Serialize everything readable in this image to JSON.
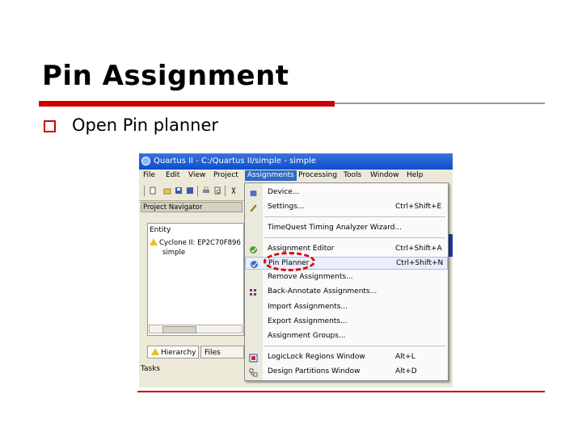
{
  "slide": {
    "title": "Pin Assignment",
    "bullet": "Open Pin planner"
  },
  "colors": {
    "accent_red": "#cc0000",
    "xp_title_blue": "#0a4ecf",
    "menu_highlight": "#316ac5"
  },
  "window": {
    "title": "Quartus II - C:/Quartus II/simple - simple",
    "menu": [
      "File",
      "Edit",
      "View",
      "Project",
      "Assignments",
      "Processing",
      "Tools",
      "Window",
      "Help"
    ],
    "active_menu": "Assignments"
  },
  "project_navigator": {
    "header": "Project Navigator",
    "column": "Entity",
    "device": "Cyclone II: EP2C70F896",
    "entity": "simple",
    "tabs": [
      "Hierarchy",
      "Files"
    ],
    "tasks_label": "Tasks"
  },
  "assignments_menu": {
    "items": [
      {
        "label": "Device...",
        "shortcut": "",
        "icon": "chip-icon"
      },
      {
        "label": "Settings...",
        "shortcut": "Ctrl+Shift+E",
        "icon": "pencil-icon"
      },
      {
        "label": "TimeQuest Timing Analyzer Wizard...",
        "shortcut": "",
        "icon": ""
      },
      {
        "label": "Assignment Editor",
        "shortcut": "Ctrl+Shift+A",
        "icon": "editor-icon"
      },
      {
        "label": "Pin Planner",
        "shortcut": "Ctrl+Shift+N",
        "icon": "pin-planner-icon",
        "highlighted": true
      },
      {
        "label": "Remove Assignments...",
        "shortcut": "",
        "icon": ""
      },
      {
        "label": "Back-Annotate Assignments...",
        "shortcut": "",
        "icon": "annotate-icon"
      },
      {
        "label": "Import Assignments...",
        "shortcut": "",
        "icon": ""
      },
      {
        "label": "Export Assignments...",
        "shortcut": "",
        "icon": ""
      },
      {
        "label": "Assignment Groups...",
        "shortcut": "",
        "icon": ""
      },
      {
        "label": "LogicLock Regions Window",
        "shortcut": "Alt+L",
        "icon": "logiclock-icon"
      },
      {
        "label": "Design Partitions Window",
        "shortcut": "Alt+D",
        "icon": "partition-icon"
      }
    ]
  }
}
